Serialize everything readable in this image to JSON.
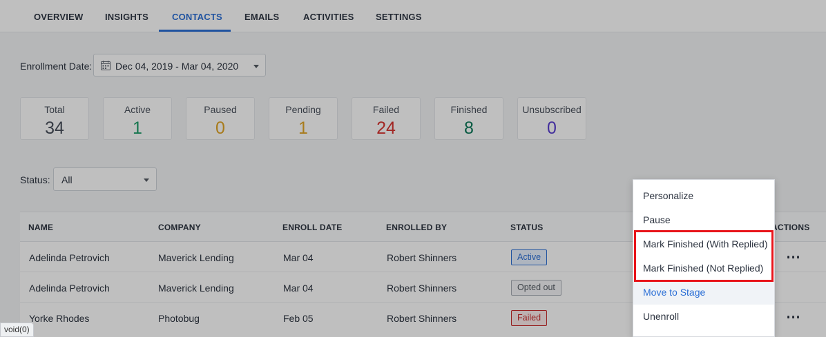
{
  "tabs": [
    {
      "label": "OVERVIEW"
    },
    {
      "label": "INSIGHTS"
    },
    {
      "label": "CONTACTS"
    },
    {
      "label": "EMAILS"
    },
    {
      "label": "ACTIVITIES"
    },
    {
      "label": "SETTINGS"
    }
  ],
  "active_tab": "CONTACTS",
  "enrollment": {
    "label": "Enrollment Date:",
    "range": "Dec 04, 2019 - Mar 04, 2020"
  },
  "stats": [
    {
      "label": "Total",
      "value": "34",
      "color": "#4a515c"
    },
    {
      "label": "Active",
      "value": "1",
      "color": "#1e9e6a"
    },
    {
      "label": "Paused",
      "value": "0",
      "color": "#e0a526"
    },
    {
      "label": "Pending",
      "value": "1",
      "color": "#e0a526"
    },
    {
      "label": "Failed",
      "value": "24",
      "color": "#d9332f"
    },
    {
      "label": "Finished",
      "value": "8",
      "color": "#0e7a5a"
    },
    {
      "label": "Unsubscribed",
      "value": "0",
      "color": "#5a3fd1"
    }
  ],
  "status_filter": {
    "label": "Status:",
    "value": "All"
  },
  "table": {
    "columns": [
      "NAME",
      "COMPANY",
      "ENROLL DATE",
      "ENROLLED BY",
      "STATUS",
      "ACTIONS"
    ],
    "rows": [
      {
        "name": "Adelinda Petrovich",
        "company": "Maverick Lending",
        "enroll_date": "Mar 04",
        "enrolled_by": "Robert Shinners",
        "status": "Active"
      },
      {
        "name": "Adelinda Petrovich",
        "company": "Maverick Lending",
        "enroll_date": "Mar 04",
        "enrolled_by": "Robert Shinners",
        "status": "Opted out"
      },
      {
        "name": "Yorke Rhodes",
        "company": "Photobug",
        "enroll_date": "Feb 05",
        "enrolled_by": "Robert Shinners",
        "status": "Failed"
      }
    ],
    "actions_glyph": "···"
  },
  "menu": {
    "items": [
      {
        "label": "Personalize"
      },
      {
        "label": "Pause"
      },
      {
        "label": "Mark Finished (With Replied)"
      },
      {
        "label": "Mark Finished (Not Replied)"
      },
      {
        "label": "Move to Stage"
      },
      {
        "label": "Unenroll"
      }
    ]
  },
  "status_tip": "void(0)",
  "icons": {
    "calendar": "calendar-icon",
    "dropdown": "chevron-down-icon"
  },
  "colors": {
    "accent": "#2b6fd6",
    "highlight": "#e8141a"
  }
}
